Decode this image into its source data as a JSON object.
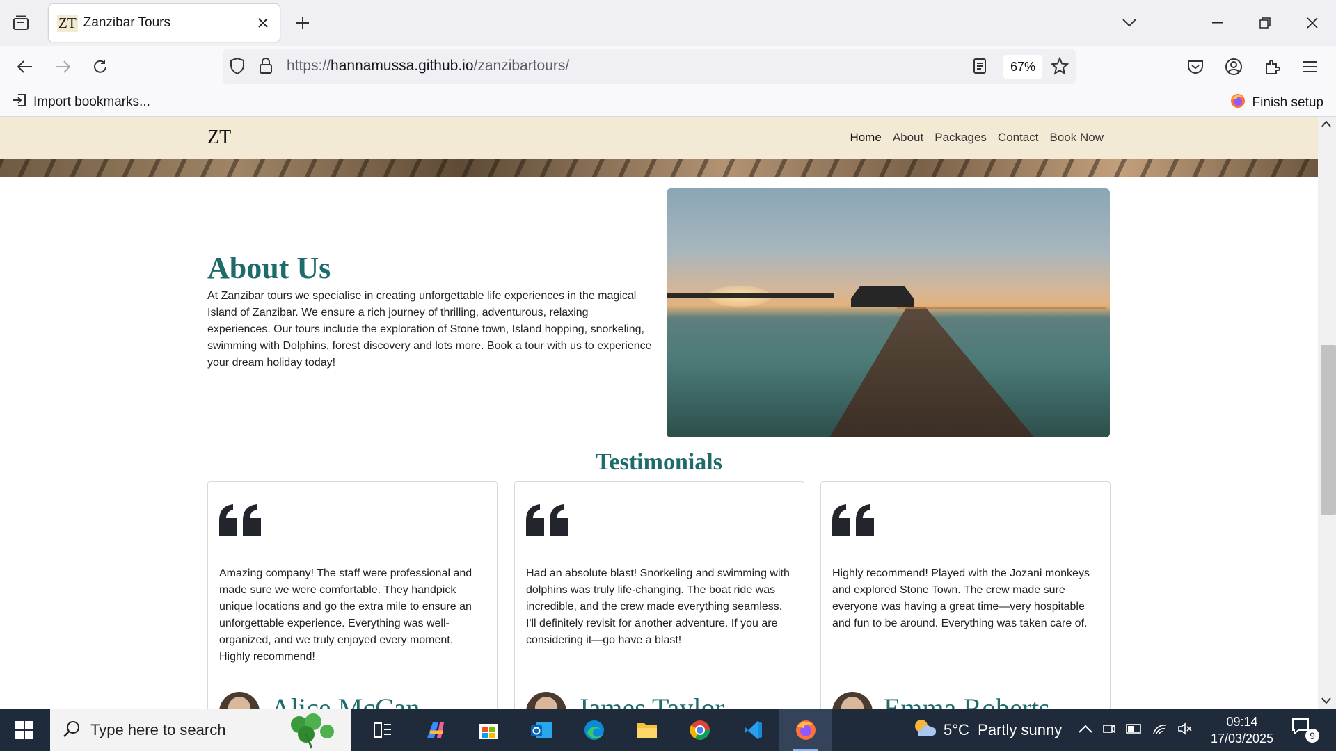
{
  "browser": {
    "tab_title": "Zanzibar Tours",
    "tab_favicon": "ZT",
    "url_prefix": "https://",
    "url_host": "hannamussa.github.io",
    "url_path": "/zanzibartours/",
    "zoom": "67%",
    "bookmark_import": "Import bookmarks...",
    "finish_setup": "Finish setup"
  },
  "site": {
    "logo": "ZT",
    "nav": [
      "Home",
      "About",
      "Packages",
      "Contact",
      "Book Now"
    ],
    "active_nav": "Home"
  },
  "about": {
    "title": "About Us",
    "text": "At Zanzibar tours we specialise in creating unforgettable life experiences in the magical Island of Zanzibar. We ensure a rich journey of thrilling, adventurous, relaxing experiences. Our tours include the exploration of Stone town, Island hopping, snorkeling, swimming with Dolphins, forest discovery and lots more. Book a tour with us to experience your dream holiday today!"
  },
  "testimonials": {
    "title": "Testimonials",
    "items": [
      {
        "text": "Amazing company! The staff were professional and made sure we were comfortable. They handpick unique locations and go the extra mile to ensure an unforgettable experience. Everything was well-organized, and we truly enjoyed every moment. Highly recommend!",
        "name": "Alice McCan"
      },
      {
        "text": "Had an absolute blast! Snorkeling and swimming with dolphins was truly life-changing. The boat ride was incredible, and the crew made everything seamless. I'll definitely revisit for another adventure. If you are considering it—go have a blast!",
        "name": "James Taylor"
      },
      {
        "text": "Highly recommend! Played with the Jozani monkeys and explored Stone Town. The crew made sure everyone was having a great time—very hospitable and fun to be around. Everything was taken care of.",
        "name": "Emma Roberts"
      }
    ]
  },
  "taskbar": {
    "search_placeholder": "Type here to search",
    "weather": "5°C  Partly sunny",
    "time": "09:14",
    "date": "17/03/2025",
    "notifications": "9"
  },
  "colors": {
    "accent_teal": "#1d6b6a",
    "header_bg": "#f3ead6"
  }
}
